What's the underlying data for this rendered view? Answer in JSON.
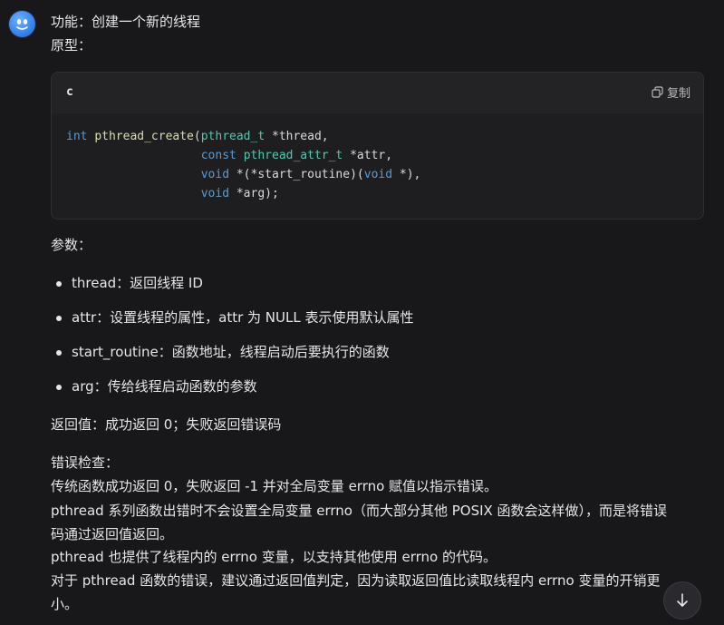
{
  "message": {
    "function_line": "功能：创建一个新的线程",
    "prototype_label": "原型：",
    "code": {
      "lang": "c",
      "copy_label": "复制",
      "lines": [
        {
          "parts": [
            [
              "int",
              "kw"
            ],
            [
              " ",
              ""
            ],
            [
              "pthread_create",
              "fn"
            ],
            [
              "(",
              ""
            ],
            [
              "pthread_t",
              "ty"
            ],
            [
              " *thread,",
              ""
            ]
          ]
        },
        {
          "parts": [
            [
              "                   ",
              ""
            ],
            [
              "const",
              "kw"
            ],
            [
              " ",
              ""
            ],
            [
              "pthread_attr_t",
              "ty"
            ],
            [
              " *attr,",
              ""
            ]
          ]
        },
        {
          "parts": [
            [
              "                   ",
              ""
            ],
            [
              "void",
              "kw"
            ],
            [
              " *(*start_routine)(",
              ""
            ],
            [
              "void",
              "kw"
            ],
            [
              " *),",
              ""
            ]
          ]
        },
        {
          "parts": [
            [
              "                   ",
              ""
            ],
            [
              "void",
              "kw"
            ],
            [
              " *arg);",
              ""
            ]
          ]
        }
      ]
    },
    "params_label": "参数：",
    "params": [
      "thread：返回线程 ID",
      "attr：设置线程的属性，attr 为 NULL 表示使用默认属性",
      "start_routine：函数地址，线程启动后要执行的函数",
      "arg：传给线程启动函数的参数"
    ],
    "return_line": "返回值：成功返回 0；失败返回错误码",
    "error_label": "错误检查：",
    "error_lines": [
      "传统函数成功返回 0，失败返回 -1 并对全局变量 errno 赋值以指示错误。",
      "pthread 系列函数出错时不会设置全局变量 errno（而大部分其他 POSIX 函数会这样做），而是将错误",
      "码通过返回值返回。",
      "pthread 也提供了线程内的 errno 变量，以支持其他使用 errno 的代码。",
      "对于 pthread 函数的错误，建议通过返回值判定，因为读取返回值比读取线程内 errno 变量的开销更",
      "小。"
    ]
  },
  "icons": {
    "avatar": "assistant-avatar-icon",
    "copy": "copy-icon",
    "scroll_down": "arrow-down-icon"
  }
}
